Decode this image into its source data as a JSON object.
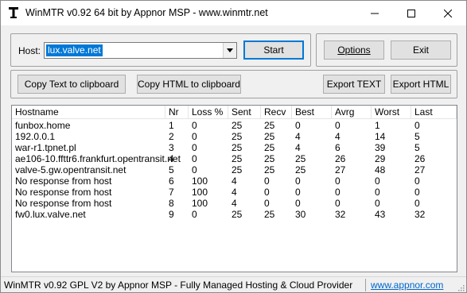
{
  "window": {
    "title": "WinMTR v0.92 64 bit by Appnor MSP - www.winmtr.net"
  },
  "host": {
    "label": "Host:",
    "value": "lux.valve.net"
  },
  "buttons": {
    "start": "Start",
    "options": "Options",
    "exit": "Exit",
    "copy_text": "Copy Text to clipboard",
    "copy_html": "Copy HTML to clipboard",
    "export_text": "Export TEXT",
    "export_html": "Export HTML"
  },
  "table": {
    "columns": [
      "Hostname",
      "Nr",
      "Loss %",
      "Sent",
      "Recv",
      "Best",
      "Avrg",
      "Worst",
      "Last"
    ],
    "rows": [
      [
        "funbox.home",
        "1",
        "0",
        "25",
        "25",
        "0",
        "0",
        "1",
        "0"
      ],
      [
        "192.0.0.1",
        "2",
        "0",
        "25",
        "25",
        "4",
        "4",
        "14",
        "5"
      ],
      [
        "war-r1.tpnet.pl",
        "3",
        "0",
        "25",
        "25",
        "4",
        "6",
        "39",
        "5"
      ],
      [
        "ae106-10.ffttr6.frankfurt.opentransit.net",
        "4",
        "0",
        "25",
        "25",
        "25",
        "26",
        "29",
        "26"
      ],
      [
        "valve-5.gw.opentransit.net",
        "5",
        "0",
        "25",
        "25",
        "25",
        "27",
        "48",
        "27"
      ],
      [
        "No response from host",
        "6",
        "100",
        "4",
        "0",
        "0",
        "0",
        "0",
        "0"
      ],
      [
        "No response from host",
        "7",
        "100",
        "4",
        "0",
        "0",
        "0",
        "0",
        "0"
      ],
      [
        "No response from host",
        "8",
        "100",
        "4",
        "0",
        "0",
        "0",
        "0",
        "0"
      ],
      [
        "fw0.lux.valve.net",
        "9",
        "0",
        "25",
        "25",
        "30",
        "32",
        "43",
        "32"
      ]
    ]
  },
  "statusbar": {
    "text": "WinMTR v0.92 GPL V2 by Appnor MSP - Fully Managed Hosting & Cloud Provider",
    "link": "www.appnor.com"
  },
  "icons": {
    "app": "winmtr-app-icon",
    "minimize": "minimize-icon",
    "maximize": "maximize-icon",
    "close": "close-icon",
    "dropdown": "chevron-down-icon",
    "grip": "resize-grip-icon"
  },
  "colors": {
    "selection": "#0078d7",
    "link": "#0066cc",
    "face": "#f0f0f0"
  }
}
